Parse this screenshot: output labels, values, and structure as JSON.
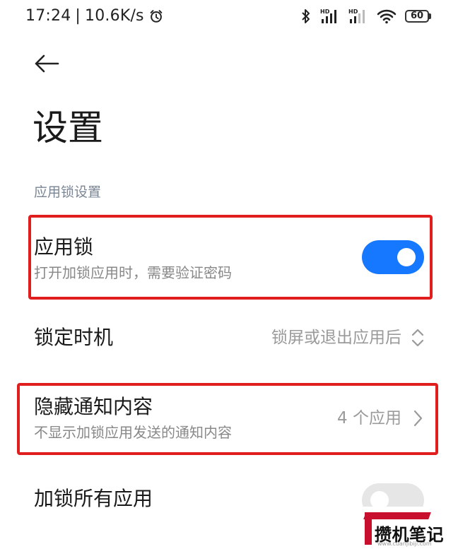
{
  "status_bar": {
    "time": "17:24",
    "speed": "10.6K/s",
    "battery": "60",
    "icons": [
      "alarm-icon",
      "bluetooth-icon",
      "hd-signal-icon",
      "wifi-icon",
      "battery-icon"
    ]
  },
  "header": {
    "title": "设置"
  },
  "section": {
    "title": "应用锁设置"
  },
  "rows": [
    {
      "title": "应用锁",
      "subtitle": "打开加锁应用时，需要验证密码",
      "toggle": "on"
    },
    {
      "title": "锁定时机",
      "value": "锁屏或退出应用后"
    },
    {
      "title": "隐藏通知内容",
      "subtitle": "不显示加锁应用发送的通知内容",
      "value": "4 个应用"
    },
    {
      "title": "加锁所有应用",
      "toggle": "off"
    }
  ],
  "watermark": {
    "text": "攒机笔记",
    "url": "www.cuanjibiji.com"
  },
  "colors": {
    "accent": "#1677ff",
    "highlight": "#e01e1e"
  }
}
